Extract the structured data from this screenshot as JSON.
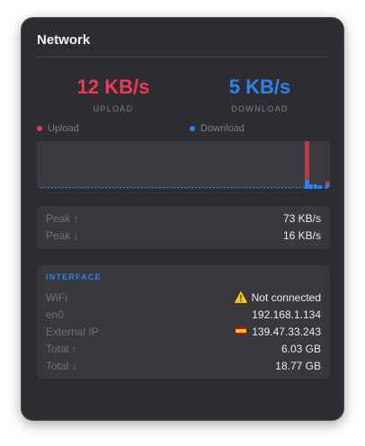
{
  "window": {
    "title": "Network"
  },
  "speeds": {
    "upload_value": "12 KB/s",
    "upload_label": "UPLOAD",
    "download_value": "5 KB/s",
    "download_label": "DOWNLOAD"
  },
  "legend": {
    "upload": "Upload",
    "download": "Download"
  },
  "colors": {
    "upload": "#e93a56",
    "download": "#2a84f0",
    "panel_bg": "#2e2e32",
    "card_bg": "#38383d"
  },
  "peak": {
    "upload_label": "Peak ↑",
    "upload_value": "73 KB/s",
    "download_label": "Peak ↓",
    "download_value": "16 KB/s"
  },
  "interface": {
    "section_label": "INTERFACE",
    "rows": [
      {
        "label": "WiFi",
        "value": "Not connected",
        "icon": "warning-icon"
      },
      {
        "label": "en0",
        "value": "192.168.1.134"
      },
      {
        "label": "External IP",
        "value": "139.47.33.243",
        "icon": "spain-flag-icon"
      },
      {
        "label": "Total ↑",
        "value": "6.03 GB"
      },
      {
        "label": "Total ↓",
        "value": "18.77 GB"
      }
    ]
  }
}
